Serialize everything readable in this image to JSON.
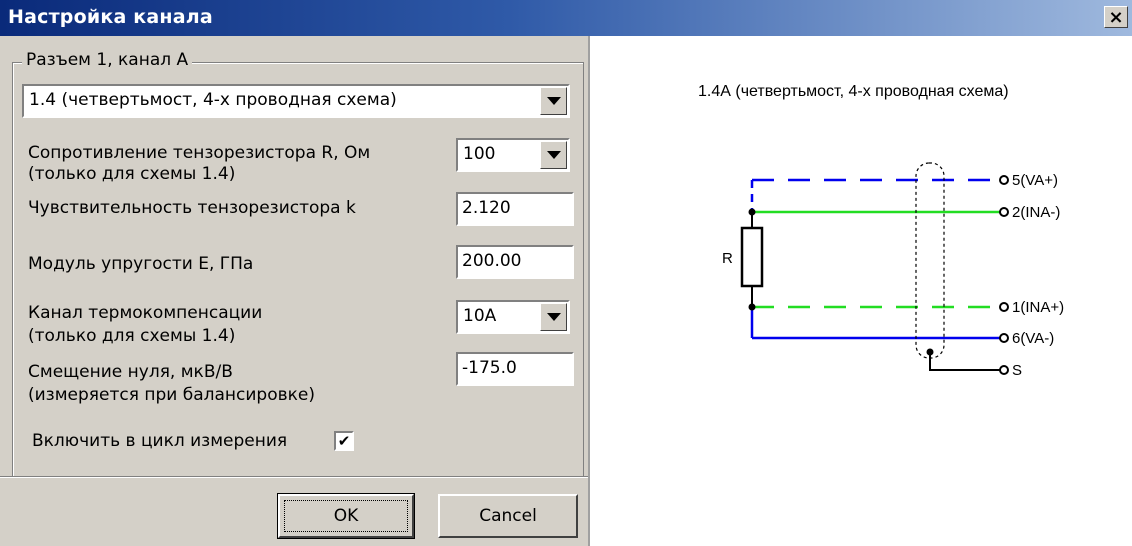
{
  "window": {
    "title": "Настройка канала",
    "close_label": "×"
  },
  "group": {
    "label": "Разъем 1, канал А"
  },
  "scheme": {
    "selected": "1.4 (четвертьмост, 4-х проводная схема)"
  },
  "fields": {
    "resistance": {
      "label1": "Сопротивление тензорезистора R, Ом",
      "label2": "(только для схемы 1.4)",
      "value": "100"
    },
    "sensitivity": {
      "label": "Чувствительность тензорезистора k",
      "value": "2.120"
    },
    "modulus": {
      "label": "Модуль упругости E, ГПа",
      "value": "200.00"
    },
    "thermo": {
      "label1": "Канал термокомпенсации",
      "label2": "(только для схемы 1.4)",
      "value": "10A"
    },
    "offset": {
      "label1": "Смещение нуля, мкВ/В",
      "label2": "(измеряется при балансировке)",
      "value": "-175.0"
    }
  },
  "include": {
    "label": "Включить в цикл измерения",
    "checked": "✔"
  },
  "buttons": {
    "ok": "OK",
    "cancel": "Cancel"
  },
  "diagram": {
    "title": "1.4А (четвертьмост, 4-х проводная схема)",
    "resistor_label": "R",
    "pins": [
      "5(VA+)",
      "2(INA-)",
      "1(INA+)",
      "6(VA-)",
      "S"
    ],
    "colors": {
      "va": "#0000ee",
      "ina": "#22dd22",
      "shield": "#000000"
    }
  }
}
